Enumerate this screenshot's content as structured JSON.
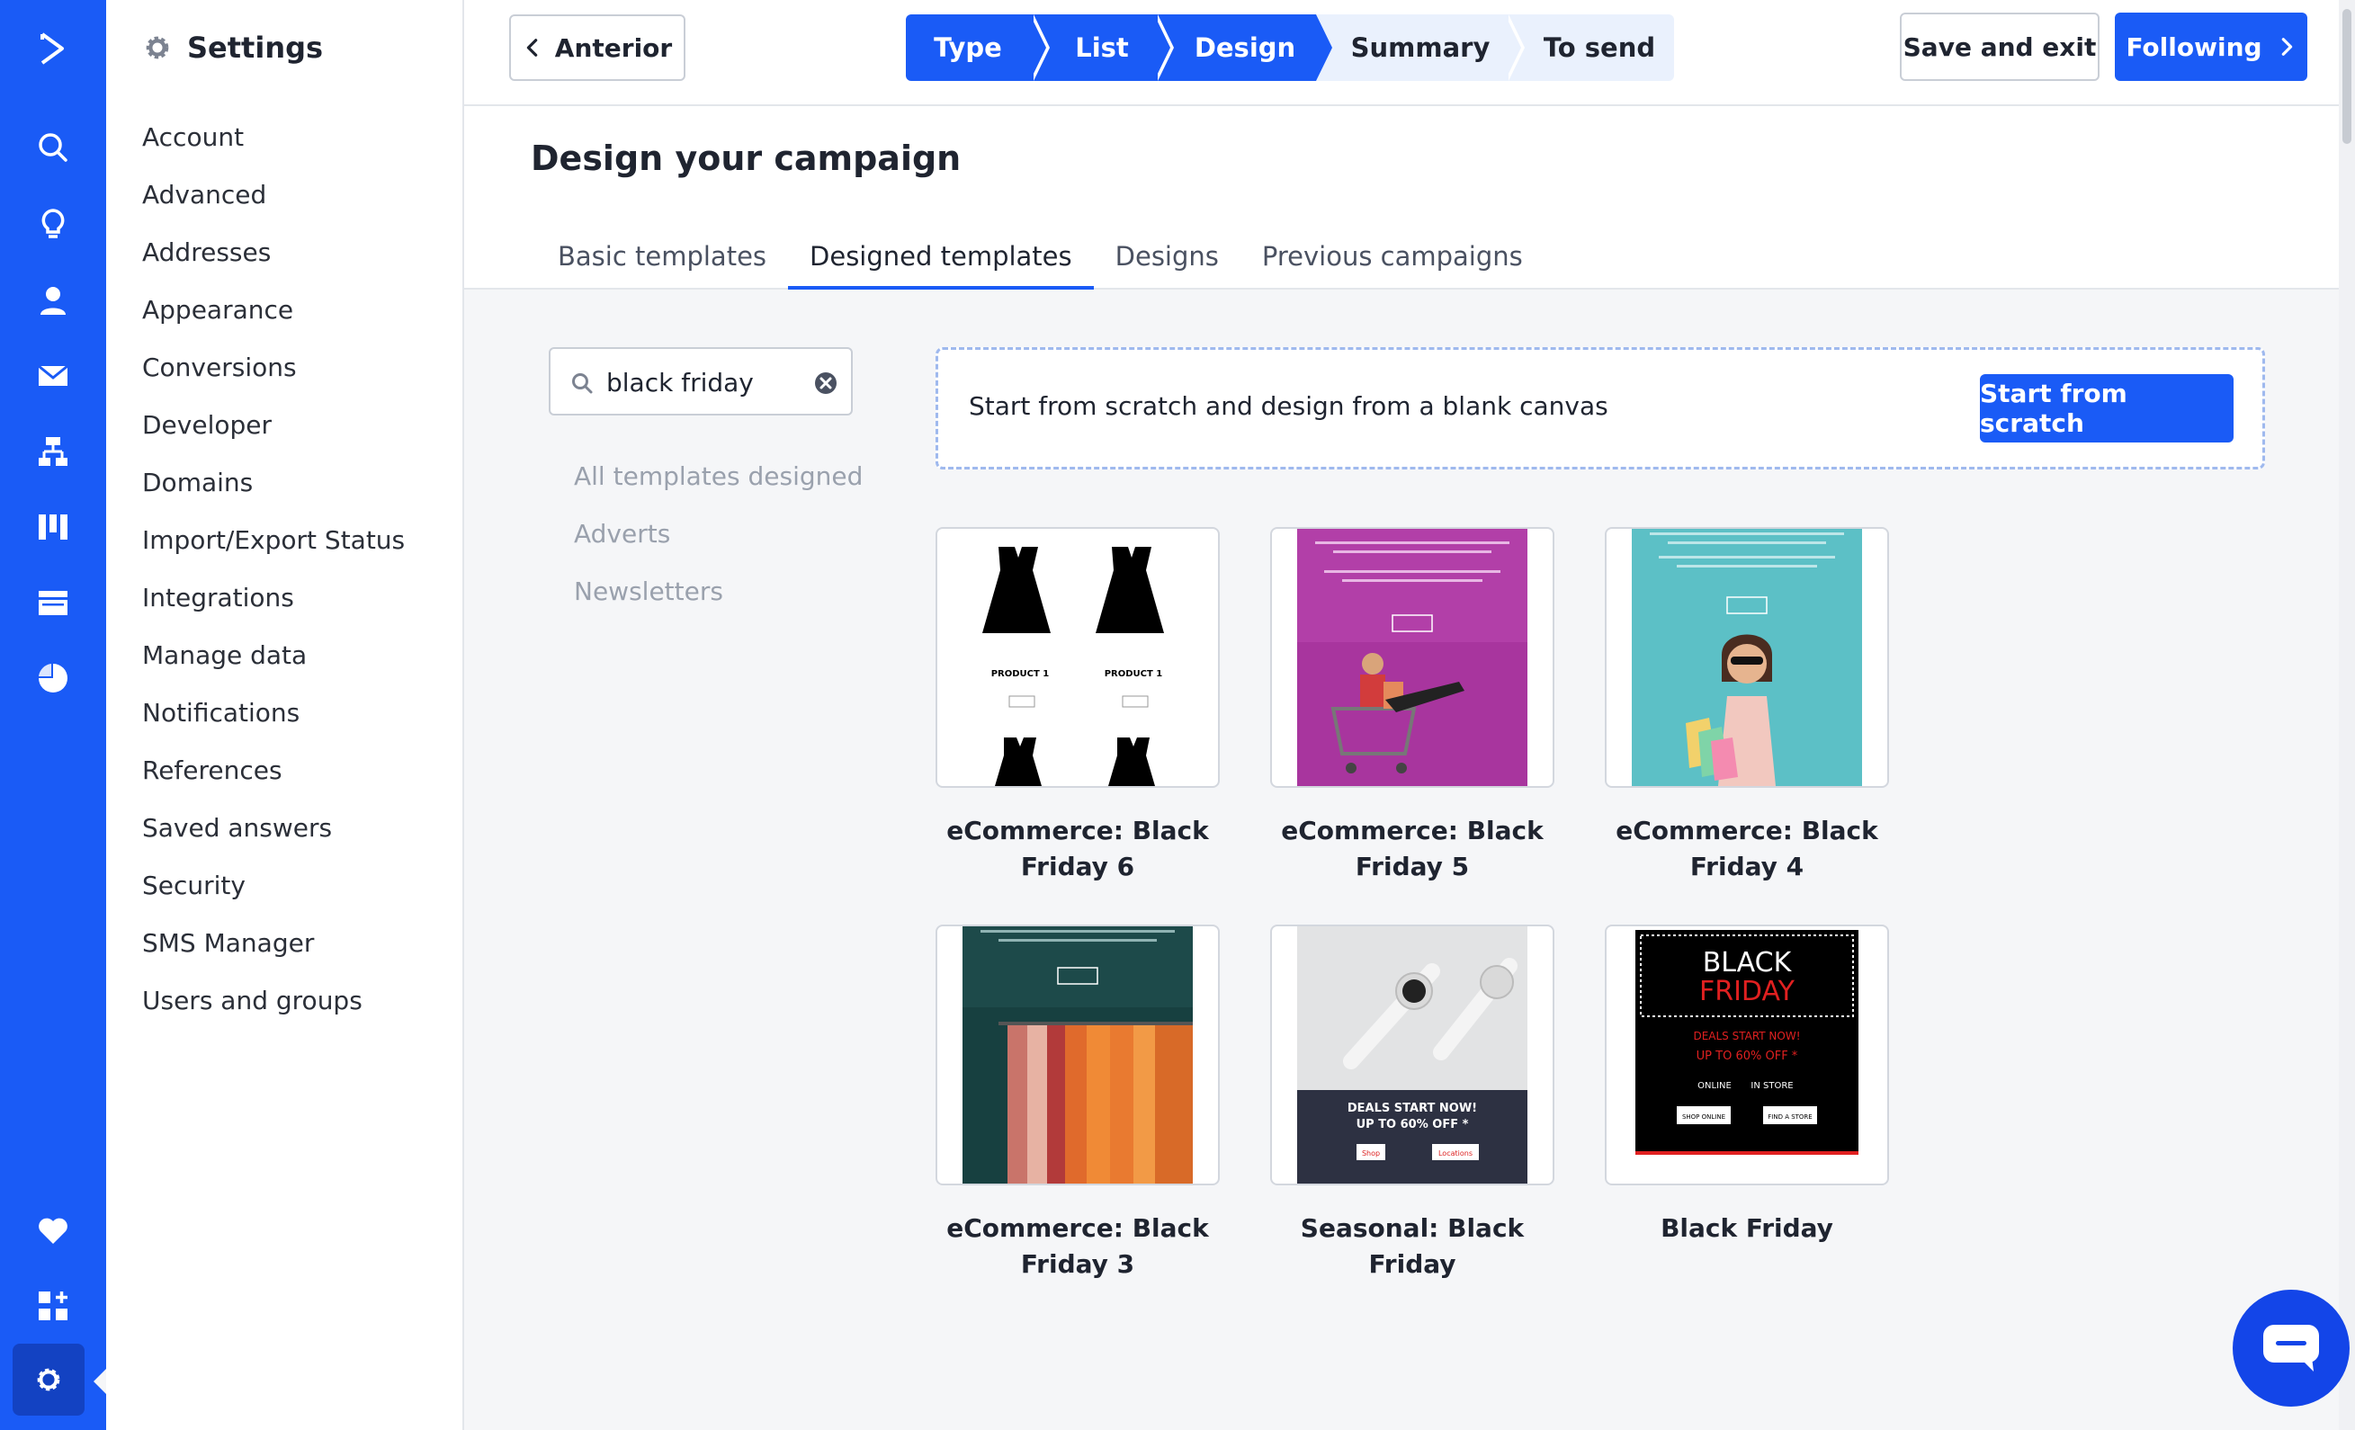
{
  "colors": {
    "brand": "#1a5bf6",
    "step_todo": "#eaf1fd",
    "content_bg": "#f5f6f8"
  },
  "rail": {
    "icons": [
      "logo-icon",
      "search-icon",
      "lightbulb-icon",
      "contacts-icon",
      "campaigns-icon",
      "automations-icon",
      "deals-icon",
      "website-icon",
      "reports-icon",
      "heart-icon",
      "apps-icon",
      "gear-icon"
    ]
  },
  "settings": {
    "title": "Settings",
    "items": [
      "Account",
      "Advanced",
      "Addresses",
      "Appearance",
      "Conversions",
      "Developer",
      "Domains",
      "Import/Export Status",
      "Integrations",
      "Manage data",
      "Notifications",
      "References",
      "Saved answers",
      "Security",
      "SMS Manager",
      "Users and groups"
    ]
  },
  "topbar": {
    "back_label": "Anterior",
    "steps": [
      {
        "label": "Type",
        "state": "done"
      },
      {
        "label": "List",
        "state": "done"
      },
      {
        "label": "Design",
        "state": "current"
      },
      {
        "label": "Summary",
        "state": "todo"
      },
      {
        "label": "To send",
        "state": "todo"
      }
    ],
    "save_label": "Save and exit",
    "next_label": "Following"
  },
  "header": {
    "title": "Design your campaign",
    "tabs": [
      {
        "label": "Basic templates",
        "active": false
      },
      {
        "label": "Designed templates",
        "active": true
      },
      {
        "label": "Designs",
        "active": false
      },
      {
        "label": "Previous campaigns",
        "active": false
      }
    ]
  },
  "search": {
    "value": "black friday"
  },
  "categories": [
    "All templates designed",
    "Adverts",
    "Newsletters"
  ],
  "scratch": {
    "text": "Start from scratch and design from a blank canvas",
    "button_label": "Start from scratch"
  },
  "templates": [
    {
      "name": "eCommerce: Black Friday 6",
      "line1": "eCommerce: Black",
      "line2": "Friday 6",
      "product1": "PRODUCT 1",
      "product2": "PRODUCT 1"
    },
    {
      "name": "eCommerce: Black Friday 5",
      "line1": "eCommerce: Black",
      "line2": "Friday 5"
    },
    {
      "name": "eCommerce: Black Friday 4",
      "line1": "eCommerce: Black",
      "line2": "Friday 4"
    },
    {
      "name": "eCommerce: Black Friday 3",
      "line1": "eCommerce: Black",
      "line2": "Friday 3"
    },
    {
      "name": "Seasonal: Black Friday",
      "line1": "Seasonal: Black Friday",
      "line2": "",
      "deal1": "DEALS START NOW!",
      "deal2": "UP TO 60% OFF *",
      "btn1": "Shop",
      "btn2": "Locations"
    },
    {
      "name": "Black Friday",
      "line1": "Black Friday",
      "line2": "",
      "big1": "BLACK",
      "big2": "FRIDAY",
      "deal1": "DEALS START NOW!",
      "deal2": "UP TO 60% OFF *",
      "nav1": "ONLINE",
      "nav2": "IN STORE",
      "btn1": "SHOP ONLINE",
      "btn2": "FIND A STORE"
    }
  ]
}
